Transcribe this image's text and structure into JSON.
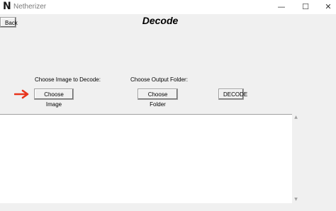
{
  "window": {
    "title": "Netherizer",
    "icon": "netherizer-logo-n",
    "controls": {
      "minimize": "—",
      "maximize": "☐",
      "close": "✕"
    }
  },
  "toolbar": {
    "back_label": "Back"
  },
  "page": {
    "heading": "Decode"
  },
  "image_section": {
    "label": "Choose Image to Decode:",
    "button_label": "Choose Image"
  },
  "output_section": {
    "label": "Choose Output Folder:",
    "button_label": "Choose Folder"
  },
  "decode_button_label": "DECODE",
  "annotation": {
    "arrow_color": "#e8341c"
  },
  "output_box": {
    "text": ""
  },
  "scrollbar": {
    "up": "▲",
    "down": "▼"
  }
}
